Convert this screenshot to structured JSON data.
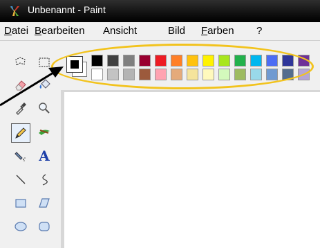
{
  "window": {
    "title": "Unbenannt - Paint"
  },
  "menu": {
    "items": [
      {
        "mnemonic": "D",
        "rest": "atei"
      },
      {
        "mnemonic": "B",
        "rest": "earbeiten"
      },
      {
        "mnemonic": "",
        "rest": "Ansicht"
      },
      {
        "mnemonic": "",
        "rest": "Bild"
      },
      {
        "mnemonic": "F",
        "rest": "arben"
      },
      {
        "mnemonic": "",
        "rest": "?"
      }
    ]
  },
  "tools": [
    {
      "name": "free-select",
      "icon": "free-select-icon"
    },
    {
      "name": "rect-select",
      "icon": "rect-select-icon"
    },
    {
      "name": "eraser",
      "icon": "eraser-icon"
    },
    {
      "name": "fill-bucket",
      "icon": "fill-bucket-icon"
    },
    {
      "name": "color-picker",
      "icon": "eyedropper-icon"
    },
    {
      "name": "magnifier",
      "icon": "magnifier-icon"
    },
    {
      "name": "pencil",
      "icon": "pencil-icon",
      "selected": true
    },
    {
      "name": "brush",
      "icon": "brush-icon"
    },
    {
      "name": "airbrush",
      "icon": "airbrush-icon"
    },
    {
      "name": "text",
      "icon": "text-icon",
      "glyph": "A"
    },
    {
      "name": "line",
      "icon": "line-icon"
    },
    {
      "name": "curve",
      "icon": "curve-icon"
    },
    {
      "name": "rectangle",
      "icon": "rectangle-icon"
    },
    {
      "name": "polygon",
      "icon": "polygon-icon"
    },
    {
      "name": "ellipse",
      "icon": "ellipse-icon"
    },
    {
      "name": "rounded-rectangle",
      "icon": "rounded-rectangle-icon"
    }
  ],
  "colors": {
    "foreground": "#000000",
    "background": "#ffffff",
    "row1": [
      "#000000",
      "#404040",
      "#7f7f7f",
      "#990030",
      "#ed1c24",
      "#ff7f27",
      "#ffc20e",
      "#fff200",
      "#a8e61d",
      "#22b14c",
      "#00b7ef",
      "#4d6df3",
      "#2f3699",
      "#6f3198"
    ],
    "row2": [
      "#ffffff",
      "#c3c3c3",
      "#b4b4b4",
      "#9c5a3c",
      "#ffa3b1",
      "#e5aa7a",
      "#f5e49c",
      "#fff9bd",
      "#d3f9bc",
      "#9dbb61",
      "#99d9ea",
      "#709ad1",
      "#546d8e",
      "#b5a5d5"
    ]
  },
  "annotation": {
    "highlight_color": "#f2c31d",
    "arrow_color": "#000000"
  }
}
